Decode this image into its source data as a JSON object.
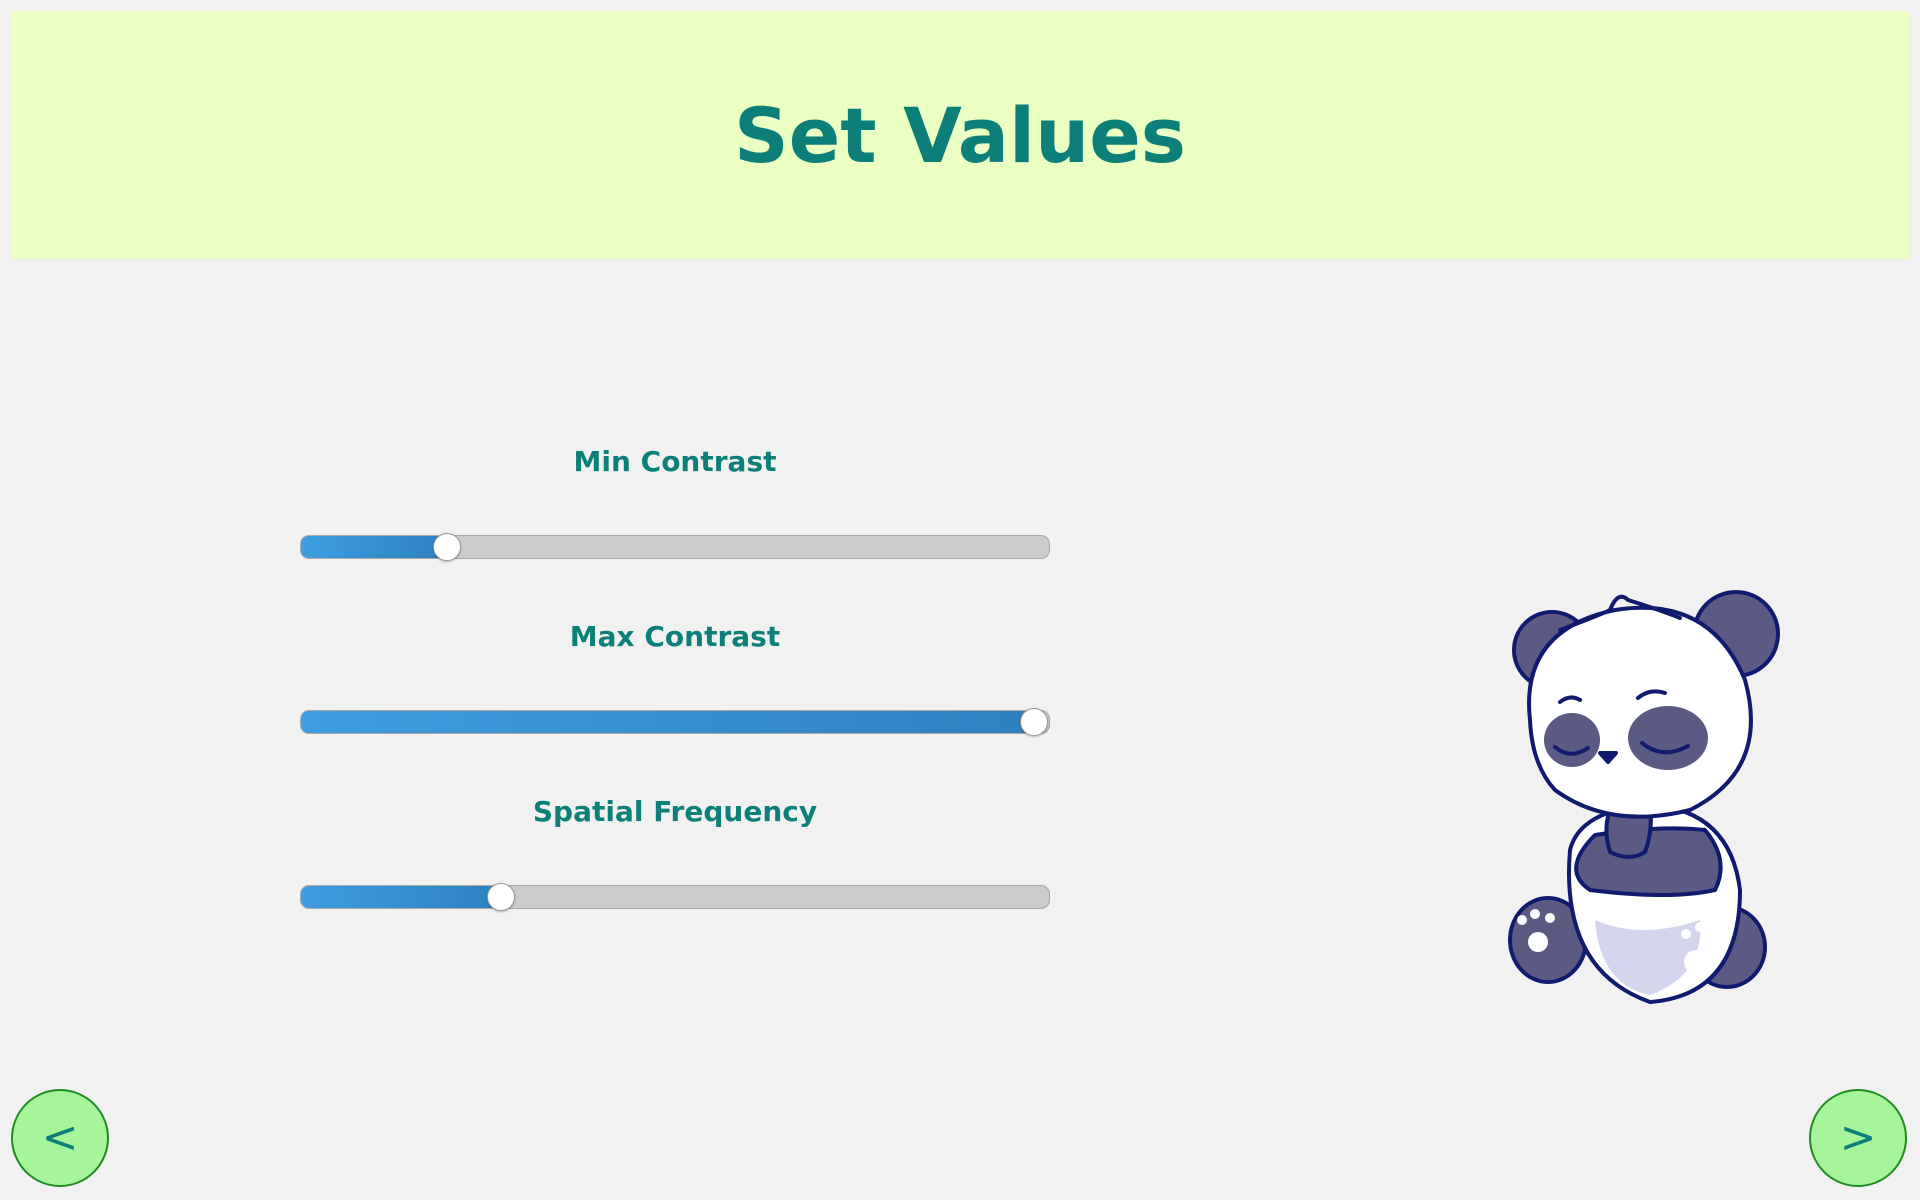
{
  "header": {
    "title": "Set Values"
  },
  "sliders": [
    {
      "label": "Min Contrast",
      "value_fraction": 0.195
    },
    {
      "label": "Max Contrast",
      "value_fraction": 0.98
    },
    {
      "label": "Spatial Frequency",
      "value_fraction": 0.268
    }
  ],
  "nav": {
    "prev_label": "<",
    "next_label": ">"
  },
  "colors": {
    "accent": "#0c8078",
    "header_bg": "#ebffc2",
    "slider_fill": "#3e9ee0",
    "nav_bg": "#a7f59a",
    "panda_dark": "#5b5a82",
    "panda_outline": "#101a6e"
  },
  "illustration": {
    "icon": "panda-illustration"
  }
}
